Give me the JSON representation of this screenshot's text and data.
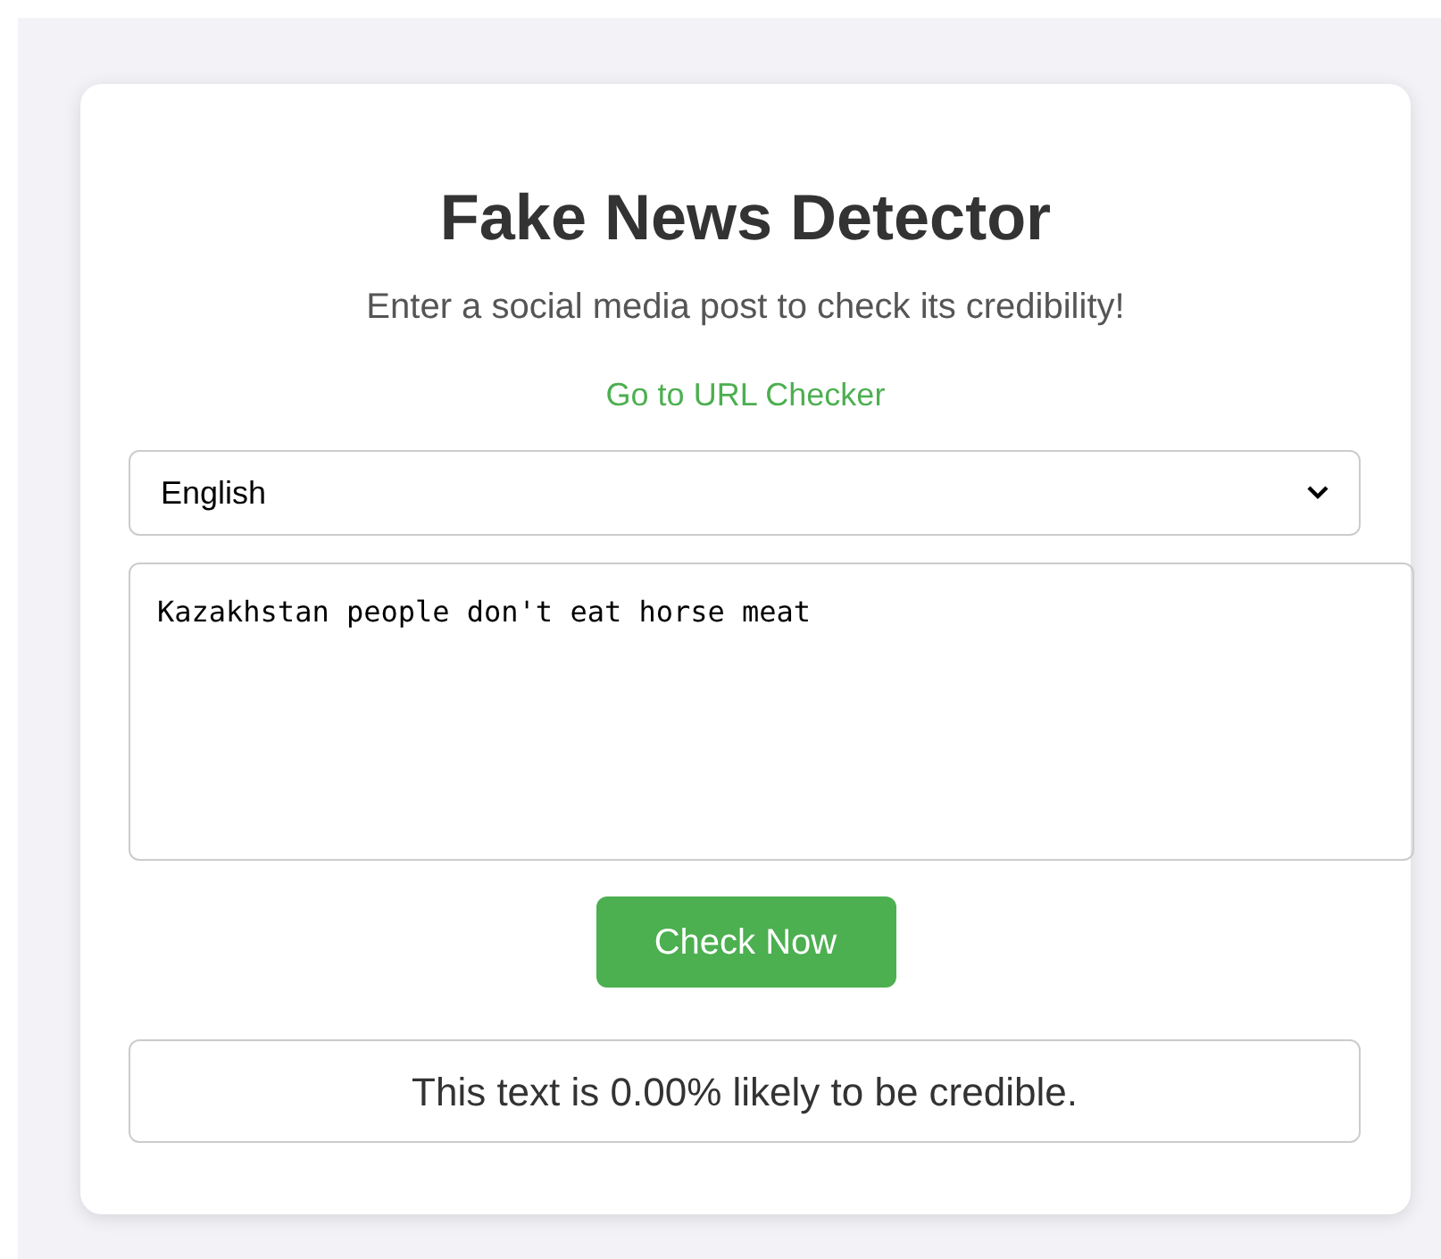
{
  "title": "Fake News Detector",
  "subtitle": "Enter a social media post to check its credibility!",
  "link": "Go to URL Checker",
  "language_select": {
    "value": "English"
  },
  "post_field": {
    "value": "Kazakhstan people don't eat horse meat"
  },
  "check_button": "Check Now",
  "result": "This text is 0.00% likely to be credible."
}
